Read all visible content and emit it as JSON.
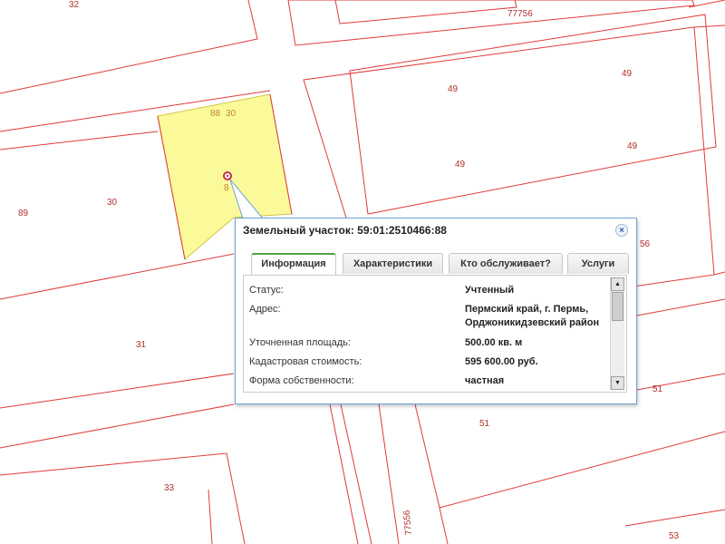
{
  "map": {
    "parcel_labels": [
      "32",
      "77756",
      "49",
      "49",
      "49",
      "49",
      "89",
      "30",
      "56",
      "31",
      "51",
      "51",
      "33",
      "53"
    ],
    "selected_parcel_labels": [
      "88",
      "30",
      "8"
    ],
    "street_label": "77556",
    "colors": {
      "boundary": "#e03a3a",
      "selected_fill": "#fafa9a",
      "selected_border": "#d6c44a",
      "label": "#b0302a"
    }
  },
  "popup": {
    "title": "Земельный участок: 59:01:2510466:88",
    "close_label": "×",
    "tabs": [
      "Информация",
      "Характеристики",
      "Кто обслуживает?",
      "Услуги"
    ],
    "active_tab": "Информация",
    "fields": [
      {
        "label": "Статус:",
        "value": "Учтенный"
      },
      {
        "label": "Адрес:",
        "value_line1": "Пермский край, г. Пермь,",
        "value_line2": "Орджоникидзевский район"
      },
      {
        "label": "Уточненная площадь:",
        "value": "500.00 кв. м"
      },
      {
        "label": "Кадастровая стоимость:",
        "value": "595 600.00 руб."
      },
      {
        "label": "Форма собственности:",
        "value": "частная"
      }
    ],
    "scroll_up": "▲",
    "scroll_down": "▼"
  }
}
